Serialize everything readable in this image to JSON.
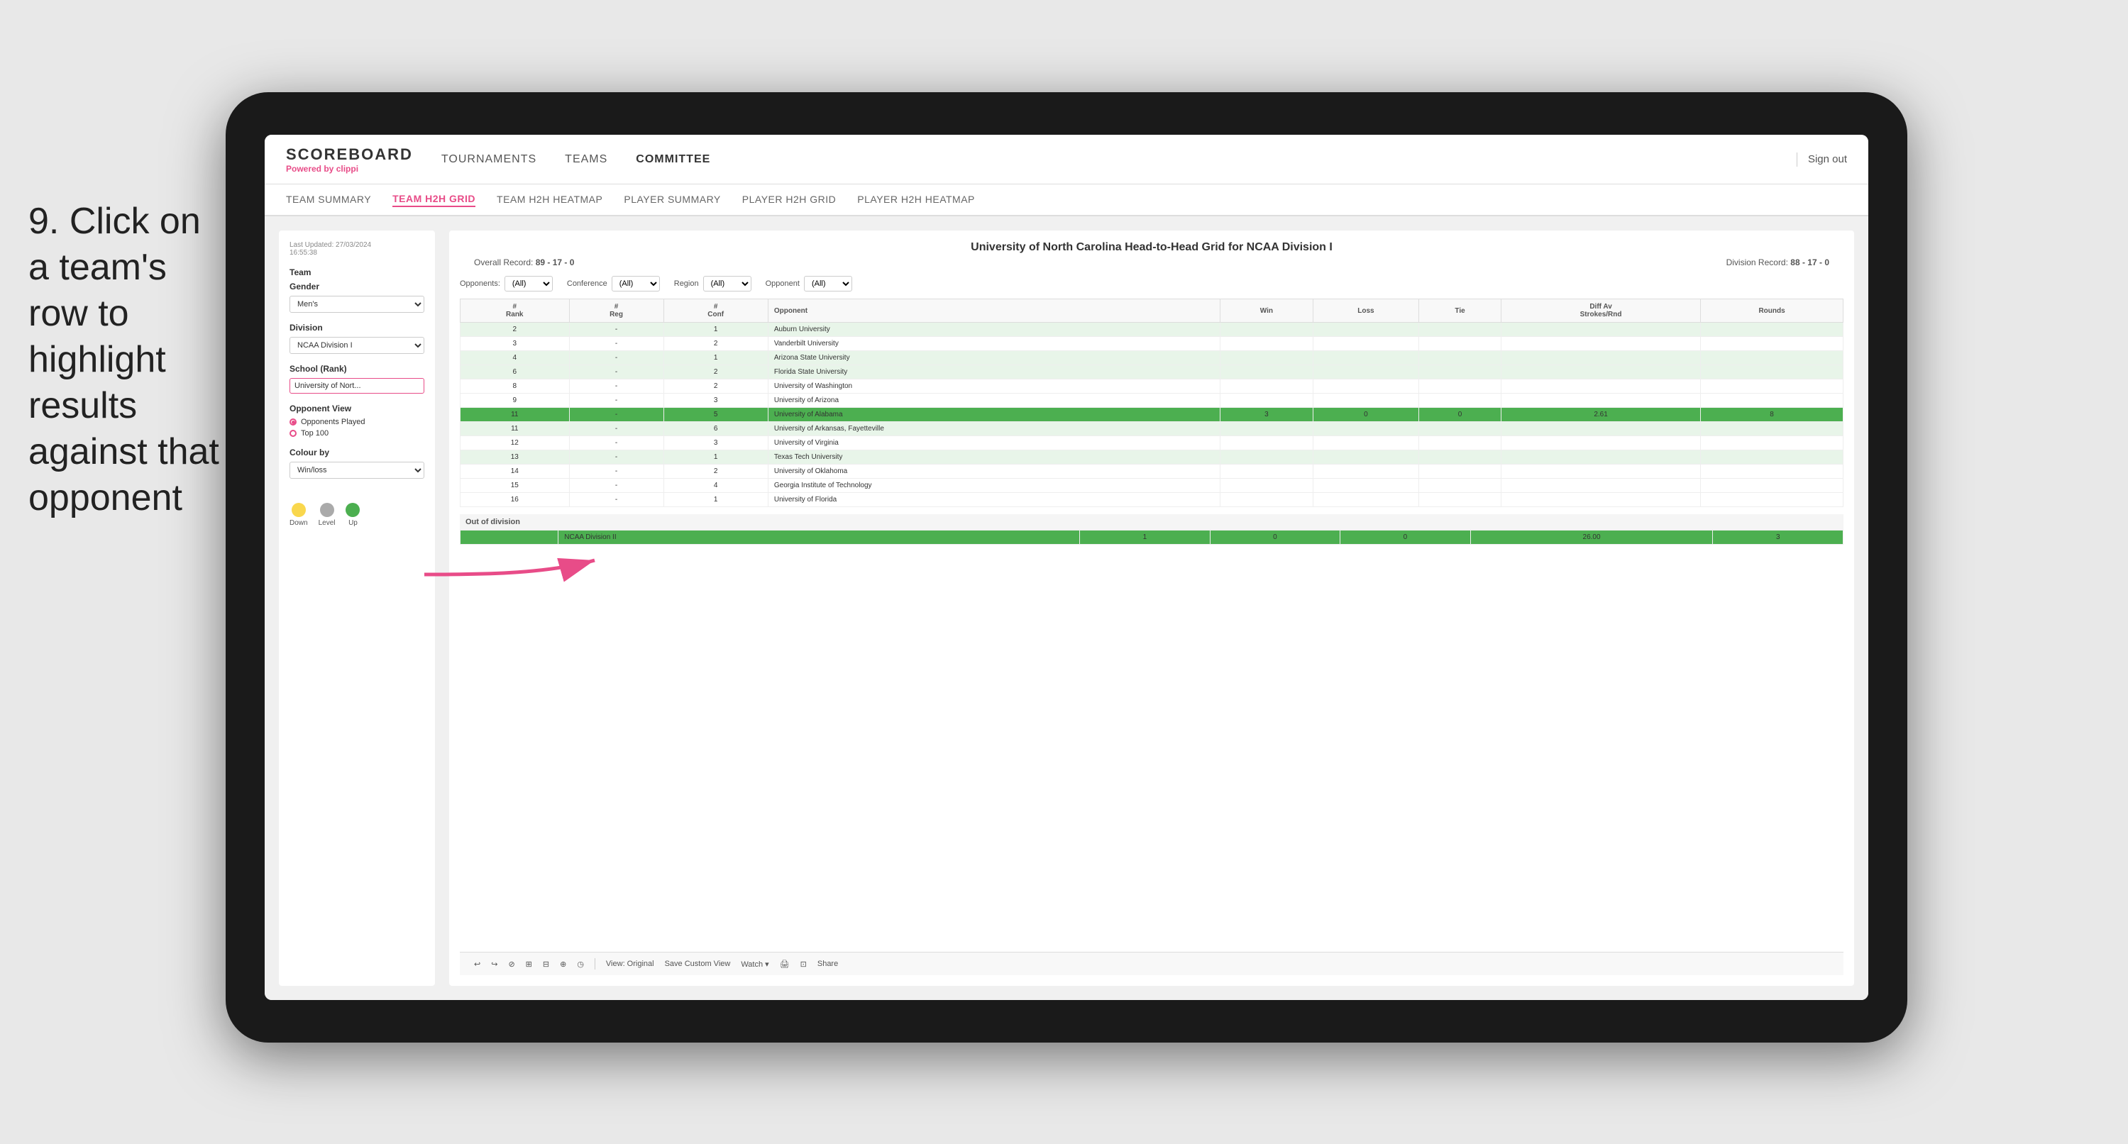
{
  "instruction": {
    "step": "9.",
    "text": "Click on a team's row to highlight results against that opponent"
  },
  "nav": {
    "logo": "SCOREBOARD",
    "powered_by": "Powered by",
    "brand": "clippi",
    "items": [
      "TOURNAMENTS",
      "TEAMS",
      "COMMITTEE"
    ],
    "active_item": "COMMITTEE",
    "sign_out": "Sign out"
  },
  "sub_nav": {
    "items": [
      "TEAM SUMMARY",
      "TEAM H2H GRID",
      "TEAM H2H HEATMAP",
      "PLAYER SUMMARY",
      "PLAYER H2H GRID",
      "PLAYER H2H HEATMAP"
    ],
    "active": "TEAM H2H GRID"
  },
  "left_panel": {
    "timestamp_label": "Last Updated: 27/03/2024",
    "time": "16:55:38",
    "team_label": "Team",
    "gender_label": "Gender",
    "gender_value": "Men's",
    "division_label": "Division",
    "division_value": "NCAA Division I",
    "school_rank_label": "School (Rank)",
    "school_rank_value": "University of Nort...",
    "opponent_view_label": "Opponent View",
    "opponent_view_options": [
      "Opponents Played",
      "Top 100"
    ],
    "opponent_view_selected": "Opponents Played",
    "colour_by_label": "Colour by",
    "colour_by_value": "Win/loss",
    "legend": [
      {
        "label": "Down",
        "color": "#f9d74d"
      },
      {
        "label": "Level",
        "color": "#aaaaaa"
      },
      {
        "label": "Up",
        "color": "#4caf50"
      }
    ]
  },
  "grid": {
    "title": "University of North Carolina Head-to-Head Grid for NCAA Division I",
    "overall_record_label": "Overall Record:",
    "overall_record": "89 - 17 - 0",
    "division_record_label": "Division Record:",
    "division_record": "88 - 17 - 0",
    "filters": {
      "opponents_label": "Opponents:",
      "opponents_value": "(All)",
      "conference_label": "Conference",
      "conference_value": "(All)",
      "region_label": "Region",
      "region_value": "(All)",
      "opponent_label": "Opponent",
      "opponent_value": "(All)"
    },
    "columns": [
      "#\nRank",
      "#\nReg",
      "#\nConf",
      "Opponent",
      "Win",
      "Loss",
      "Tie",
      "Diff Av\nStrokes/Rnd",
      "Rounds"
    ],
    "rows": [
      {
        "rank": "2",
        "reg": "-",
        "conf": "1",
        "opponent": "Auburn University",
        "win": "",
        "loss": "",
        "tie": "",
        "diff": "",
        "rounds": "",
        "style": "light-green"
      },
      {
        "rank": "3",
        "reg": "-",
        "conf": "2",
        "opponent": "Vanderbilt University",
        "win": "",
        "loss": "",
        "tie": "",
        "diff": "",
        "rounds": "",
        "style": "normal"
      },
      {
        "rank": "4",
        "reg": "-",
        "conf": "1",
        "opponent": "Arizona State University",
        "win": "",
        "loss": "",
        "tie": "",
        "diff": "",
        "rounds": "",
        "style": "light-green"
      },
      {
        "rank": "6",
        "reg": "-",
        "conf": "2",
        "opponent": "Florida State University",
        "win": "",
        "loss": "",
        "tie": "",
        "diff": "",
        "rounds": "",
        "style": "light-green"
      },
      {
        "rank": "8",
        "reg": "-",
        "conf": "2",
        "opponent": "University of Washington",
        "win": "",
        "loss": "",
        "tie": "",
        "diff": "",
        "rounds": "",
        "style": "normal"
      },
      {
        "rank": "9",
        "reg": "-",
        "conf": "3",
        "opponent": "University of Arizona",
        "win": "",
        "loss": "",
        "tie": "",
        "diff": "",
        "rounds": "",
        "style": "normal"
      },
      {
        "rank": "11",
        "reg": "-",
        "conf": "5",
        "opponent": "University of Alabama",
        "win": "3",
        "loss": "0",
        "tie": "0",
        "diff": "2.61",
        "rounds": "8",
        "style": "highlighted"
      },
      {
        "rank": "11",
        "reg": "-",
        "conf": "6",
        "opponent": "University of Arkansas, Fayetteville",
        "win": "",
        "loss": "",
        "tie": "",
        "diff": "",
        "rounds": "",
        "style": "light-green"
      },
      {
        "rank": "12",
        "reg": "-",
        "conf": "3",
        "opponent": "University of Virginia",
        "win": "",
        "loss": "",
        "tie": "",
        "diff": "",
        "rounds": "",
        "style": "normal"
      },
      {
        "rank": "13",
        "reg": "-",
        "conf": "1",
        "opponent": "Texas Tech University",
        "win": "",
        "loss": "",
        "tie": "",
        "diff": "",
        "rounds": "",
        "style": "light-green"
      },
      {
        "rank": "14",
        "reg": "-",
        "conf": "2",
        "opponent": "University of Oklahoma",
        "win": "",
        "loss": "",
        "tie": "",
        "diff": "",
        "rounds": "",
        "style": "normal"
      },
      {
        "rank": "15",
        "reg": "-",
        "conf": "4",
        "opponent": "Georgia Institute of Technology",
        "win": "",
        "loss": "",
        "tie": "",
        "diff": "",
        "rounds": "",
        "style": "normal"
      },
      {
        "rank": "16",
        "reg": "-",
        "conf": "1",
        "opponent": "University of Florida",
        "win": "",
        "loss": "",
        "tie": "",
        "diff": "",
        "rounds": "",
        "style": "normal"
      }
    ],
    "out_of_division_label": "Out of division",
    "out_of_division_rows": [
      {
        "opponent": "NCAA Division II",
        "win": "1",
        "loss": "0",
        "tie": "0",
        "diff": "26.00",
        "rounds": "3",
        "style": "highlighted"
      }
    ]
  },
  "toolbar": {
    "buttons": [
      "↩",
      "↪",
      "⊘",
      "⊞",
      "⊟",
      "⊕",
      "◷",
      "View: Original",
      "Save Custom View",
      "Watch ▾",
      "🖨",
      "⊡",
      "Share"
    ]
  }
}
